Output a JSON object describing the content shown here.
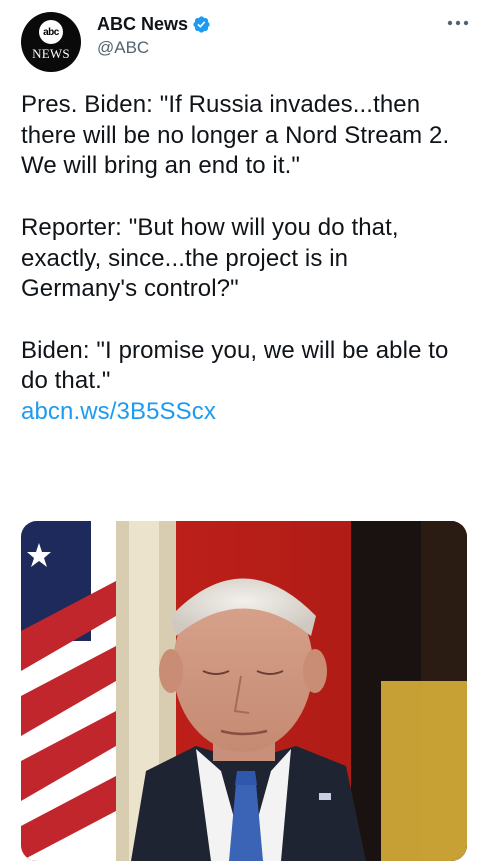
{
  "account": {
    "logo_top": "abc",
    "logo_bottom": "NEWS",
    "name": "ABC News",
    "handle": "@ABC",
    "verified": true,
    "verified_color": "#1d9bf0"
  },
  "tweet": {
    "paragraphs": [
      "Pres. Biden: \"If Russia invades...then there will be no longer a Nord Stream 2. We will bring an end to it.\"",
      "Reporter: \"But how will you do that, exactly, since...the project is in Germany's control?\"",
      "Biden: \"I promise you, we will be able to do that.\""
    ],
    "link": "abcn.ws/3B5SScx",
    "link_color": "#1d9bf0"
  },
  "icons": [
    "verified-badge-icon",
    "more-options-icon"
  ]
}
